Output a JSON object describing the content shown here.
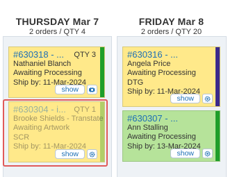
{
  "columns": [
    {
      "title": "THURSDAY Mar 7",
      "summary": "2 orders / QTY 4",
      "cards": [
        {
          "order": "#630318 - ...",
          "qty": "QTY 3",
          "name": "Nathaniel Blanch",
          "status": "Awaiting Processing",
          "ship": "Ship by: 11-Mar-2024",
          "show_label": "show",
          "stripe_color": "#1f9e2a"
        },
        {
          "order": "#630304 - i...",
          "qty": "QTY 1",
          "name": "Brooke Shields - Transtate",
          "status": "Awaiting Artwork",
          "extra": "SCR",
          "ship": "Ship by: 11-Mar-2024",
          "show_label": "show",
          "stripe_color": "#1f9e2a"
        }
      ]
    },
    {
      "title": "FRIDAY Mar 8",
      "summary": "2 orders / QTY 20",
      "cards": [
        {
          "order": "#630316 - ...",
          "qty": "",
          "name": "Angela Price",
          "status": "Awaiting Processing",
          "extra": "DTG",
          "ship": "Ship by: 11-Mar-2024",
          "show_label": "show",
          "stripe_color": "#3a2a8c"
        },
        {
          "order": "#630307 - ...",
          "qty": "",
          "name": "Ann Stalling",
          "status": "Awaiting Processing",
          "ship": "Ship by: 13-Mar-2024",
          "show_label": "show",
          "stripe_color": "#1f9e2a"
        }
      ]
    }
  ],
  "colors": {
    "card_yellow": "#ffe98a",
    "card_green": "#b6e39a",
    "link_blue": "#1c6fb5",
    "highlight_red": "#e05a5a",
    "column_bg": "#eef2f6"
  },
  "icons": [
    "gear-icon"
  ]
}
